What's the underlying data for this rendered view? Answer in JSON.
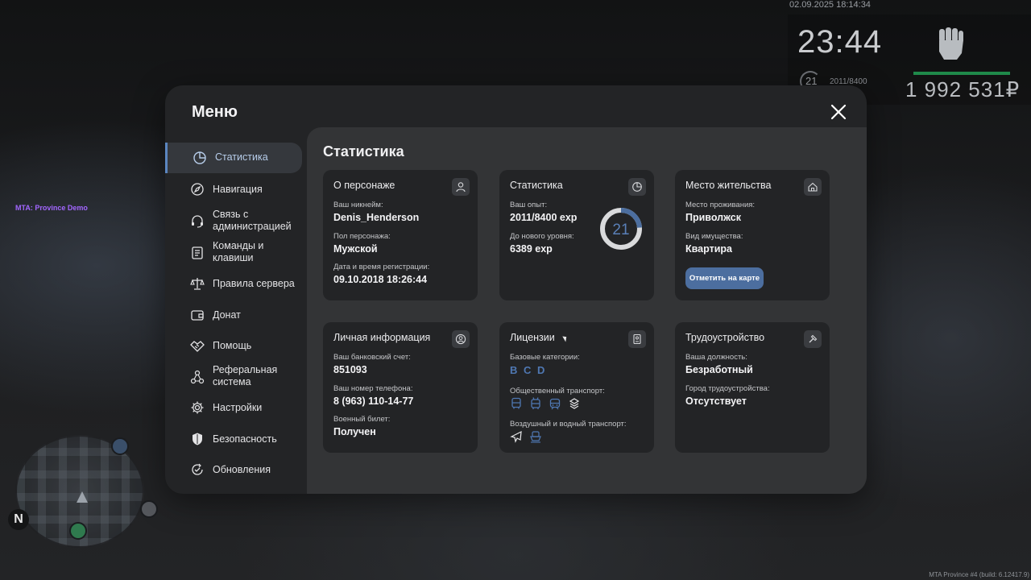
{
  "hud": {
    "datetime": "02.09.2025 18:14:34",
    "time": "23:44",
    "level": "21",
    "exp": "2011/8400",
    "money": "1 992 531₽",
    "server_tag": "MTA: Province Demo",
    "build": "MTA Province #4 (build: 6.12417.9)",
    "minimap_north": "N"
  },
  "menu": {
    "title": "Меню",
    "close_icon": "close-icon",
    "sidebar": [
      {
        "label": "Статистика",
        "icon": "pie-chart-icon",
        "active": true
      },
      {
        "label": "Навигация",
        "icon": "compass-icon",
        "active": false
      },
      {
        "label": "Связь с\nадминистрацией",
        "icon": "headset-icon",
        "active": false
      },
      {
        "label": "Команды и\nклавиши",
        "icon": "document-icon",
        "active": false
      },
      {
        "label": "Правила сервера",
        "icon": "scales-icon",
        "active": false
      },
      {
        "label": "Донат",
        "icon": "wallet-icon",
        "active": false
      },
      {
        "label": "Помощь",
        "icon": "handshake-icon",
        "active": false
      },
      {
        "label": "Реферальная\nсистема",
        "icon": "network-icon",
        "active": false
      },
      {
        "label": "Настройки",
        "icon": "gear-icon",
        "active": false
      },
      {
        "label": "Безопасность",
        "icon": "shield-icon",
        "active": false
      },
      {
        "label": "Обновления",
        "icon": "refresh-check-icon",
        "active": false
      }
    ]
  },
  "content": {
    "title": "Статистика",
    "character": {
      "title": "О персонаже",
      "icon": "user-icon",
      "nickname_label": "Ваш никнейм:",
      "nickname": "Denis_Henderson",
      "gender_label": "Пол персонажа:",
      "gender": "Мужской",
      "reg_label": "Дата и время регистрации:",
      "reg": "09.10.2018 18:26:44"
    },
    "stats": {
      "title": "Статистика",
      "icon": "pie-chart-icon",
      "exp_label": "Ваш опыт:",
      "exp": "2011/8400 exp",
      "next_label": "До нового уровня:",
      "next": "6389 exp",
      "level": "21",
      "progress": 0.2394,
      "ring_color": "#4c6e9f"
    },
    "residence": {
      "title": "Место жительства",
      "icon": "home-icon",
      "place_label": "Место проживания:",
      "place": "Приволжск",
      "property_label": "Вид имущества:",
      "property": "Квартира",
      "button": "Отметить на карте"
    },
    "personal": {
      "title": "Личная информация",
      "icon": "user-circle-icon",
      "bank_label": "Ваш банковский счет:",
      "bank": "851093",
      "phone_label": "Ваш номер телефона:",
      "phone": "8 (963) 110-14-77",
      "military_label": "Военный билет:",
      "military": "Получен"
    },
    "licenses": {
      "title": "Лицензии",
      "icon": "id-card-icon",
      "base_label": "Базовые категории:",
      "categories": [
        "B",
        "C",
        "D"
      ],
      "public_label": "Общественный транспорт:",
      "public_icons": [
        "bus-icon",
        "trolleybus-icon",
        "tram-icon",
        "taxi-icon"
      ],
      "air_label": "Воздушный и водный транспорт:",
      "air_icons": [
        "plane-icon",
        "boat-icon"
      ],
      "accent": "#4f78b3"
    },
    "employment": {
      "title": "Трудоустройство",
      "icon": "hammer-icon",
      "position_label": "Ваша должность:",
      "position": "Безработный",
      "city_label": "Город трудоустройства:",
      "city": "Отсутствует"
    }
  }
}
